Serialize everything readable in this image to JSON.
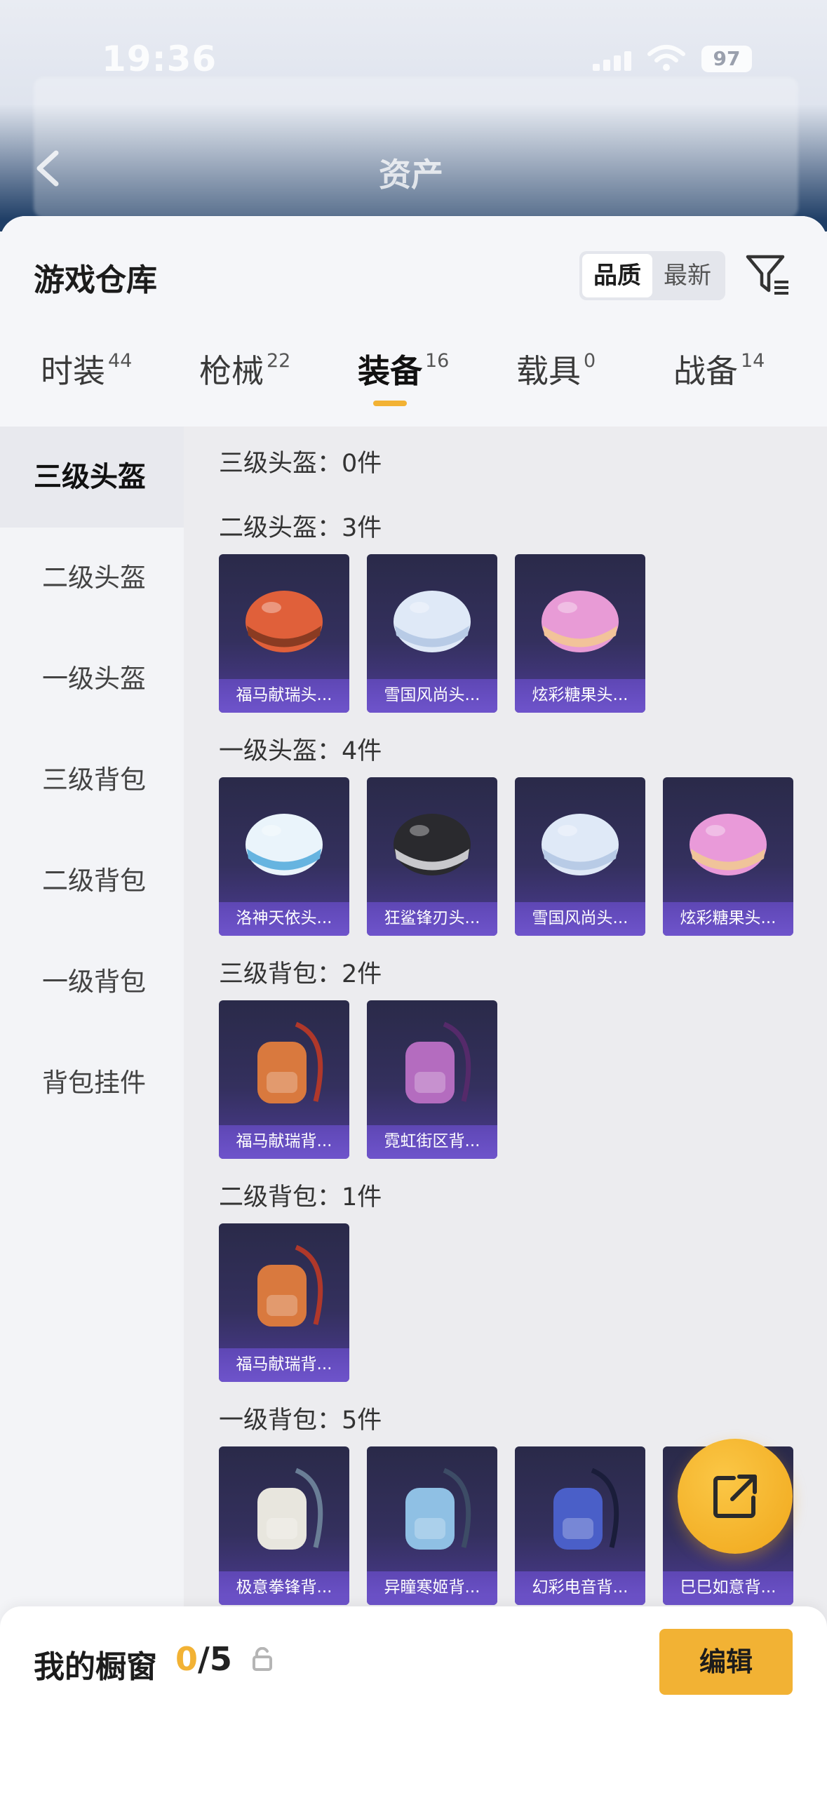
{
  "status_bar": {
    "time": "19:36",
    "battery": "97"
  },
  "nav": {
    "title": "资产"
  },
  "header": {
    "title": "游戏仓库",
    "sort_options": [
      "品质",
      "最新"
    ],
    "sort_selected": "品质"
  },
  "tabs": [
    {
      "label": "时装",
      "count": "44"
    },
    {
      "label": "枪械",
      "count": "22"
    },
    {
      "label": "装备",
      "count": "16",
      "active": true
    },
    {
      "label": "载具",
      "count": "0"
    },
    {
      "label": "战备",
      "count": "14"
    }
  ],
  "sidebar": {
    "items": [
      {
        "label": "三级头盔",
        "active": true
      },
      {
        "label": "二级头盔"
      },
      {
        "label": "一级头盔"
      },
      {
        "label": "三级背包"
      },
      {
        "label": "二级背包"
      },
      {
        "label": "一级背包"
      },
      {
        "label": "背包挂件"
      }
    ]
  },
  "sections": [
    {
      "title": "三级头盔：0件",
      "items": []
    },
    {
      "title": "二级头盔：3件",
      "items": [
        {
          "name": "福马献瑞头...",
          "icon": "helmet-orange-icon"
        },
        {
          "name": "雪国风尚头...",
          "icon": "helmet-white-icon"
        },
        {
          "name": "炫彩糖果头...",
          "icon": "helmet-pink-hat-icon"
        }
      ]
    },
    {
      "title": "一级头盔：4件",
      "items": [
        {
          "name": "洛神天依头...",
          "icon": "helmet-blue-icon"
        },
        {
          "name": "狂鲨锋刃头...",
          "icon": "helmet-black-icon"
        },
        {
          "name": "雪国风尚头...",
          "icon": "helmet-white-icon"
        },
        {
          "name": "炫彩糖果头...",
          "icon": "helmet-pink-icon"
        }
      ]
    },
    {
      "title": "三级背包：2件",
      "items": [
        {
          "name": "福马献瑞背...",
          "icon": "backpack-bunny-icon"
        },
        {
          "name": "霓虹街区背...",
          "icon": "backpack-neon-icon"
        }
      ]
    },
    {
      "title": "二级背包：1件",
      "items": [
        {
          "name": "福马献瑞背...",
          "icon": "backpack-bunny-icon"
        }
      ]
    },
    {
      "title": "一级背包：5件",
      "items": [
        {
          "name": "极意拳锋背...",
          "icon": "backpack-white-icon"
        },
        {
          "name": "异瞳寒姬背...",
          "icon": "backpack-blue-icon"
        },
        {
          "name": "幻彩电音背...",
          "icon": "backpack-speaker-icon"
        },
        {
          "name": "巳巳如意背...",
          "icon": "backpack-gold-icon"
        }
      ]
    }
  ],
  "bottom": {
    "label": "我的橱窗",
    "current": "0",
    "total": "/5",
    "edit_label": "编辑"
  },
  "colors": {
    "accent": "#f2b234",
    "card_top": "#2a2a49",
    "card_caption": "#6f55cd"
  }
}
